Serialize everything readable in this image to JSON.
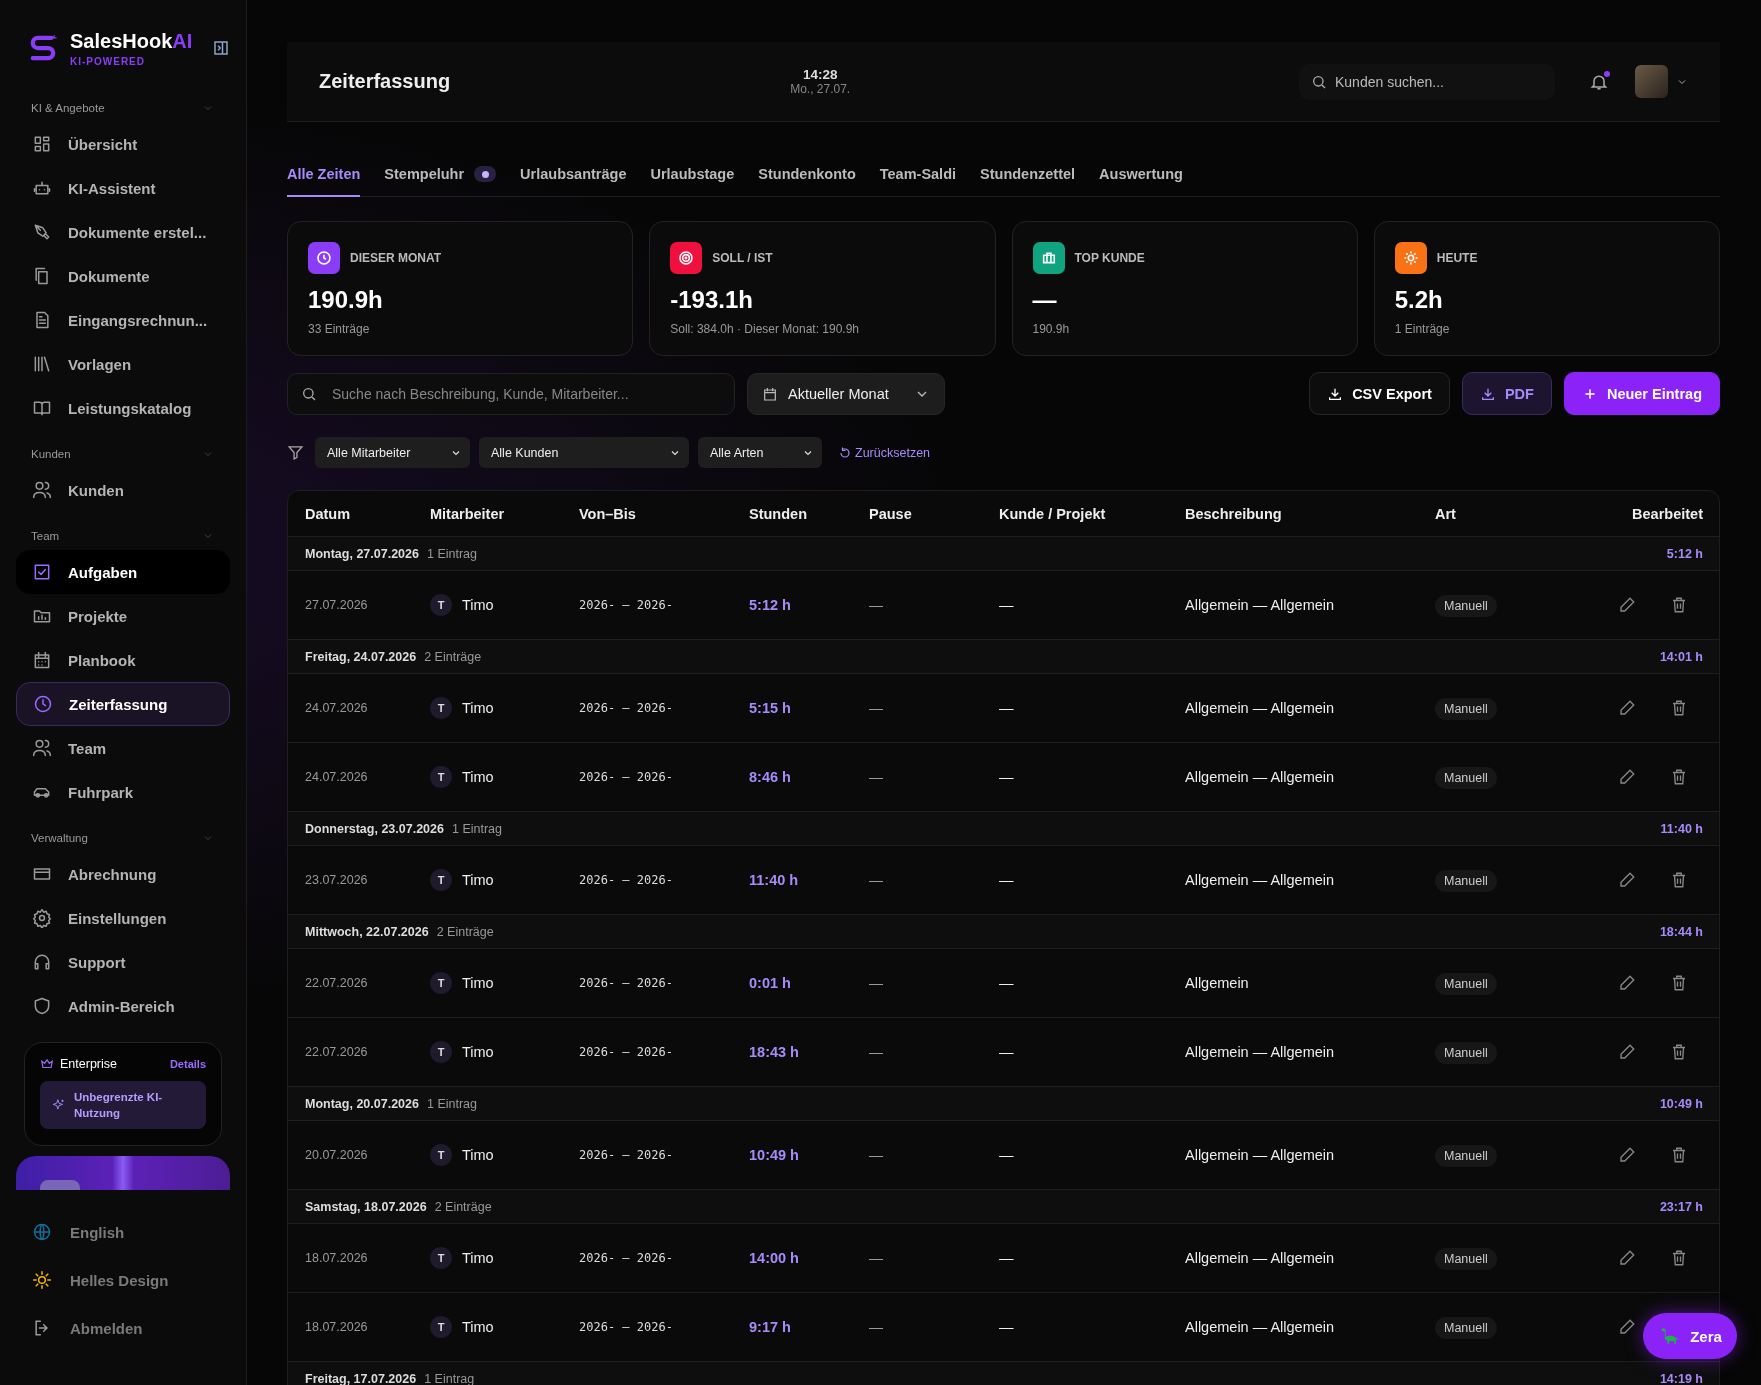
{
  "sidebar": {
    "brand": {
      "name": "SalesHook",
      "accent": "AI",
      "tagline": "KI-POWERED"
    },
    "sections": [
      {
        "title": "KI & Angebote",
        "expanded": true,
        "items": [
          {
            "label": "Übersicht",
            "selected": false,
            "hovered": false
          },
          {
            "label": "KI-Assistent",
            "selected": false,
            "hovered": false
          },
          {
            "label": "Dokumente erstel...",
            "selected": false,
            "hovered": false
          },
          {
            "label": "Dokumente",
            "selected": false,
            "hovered": false
          },
          {
            "label": "Eingangsrechnun...",
            "selected": false,
            "hovered": false
          },
          {
            "label": "Vorlagen",
            "selected": false,
            "hovered": false
          },
          {
            "label": "Leistungskatalog",
            "selected": false,
            "hovered": false
          }
        ]
      },
      {
        "title": "Kunden",
        "expanded": true,
        "items": [
          {
            "label": "Kunden",
            "selected": false,
            "hovered": false
          }
        ]
      },
      {
        "title": "Team",
        "expanded": true,
        "items": [
          {
            "label": "Aufgaben",
            "selected": false,
            "hovered": true
          },
          {
            "label": "Projekte",
            "selected": false,
            "hovered": false
          },
          {
            "label": "Planbook",
            "selected": false,
            "hovered": false
          },
          {
            "label": "Zeiterfassung",
            "selected": true,
            "hovered": false
          },
          {
            "label": "Team",
            "selected": false,
            "hovered": false
          },
          {
            "label": "Fuhrpark",
            "selected": false,
            "hovered": false
          }
        ]
      },
      {
        "title": "Verwaltung",
        "expanded": true,
        "items": [
          {
            "label": "Abrechnung",
            "selected": false,
            "hovered": false
          },
          {
            "label": "Einstellungen",
            "selected": false,
            "hovered": false
          },
          {
            "label": "Support",
            "selected": false,
            "hovered": false
          },
          {
            "label": "Admin-Bereich",
            "selected": false,
            "hovered": false
          }
        ]
      }
    ],
    "plan": {
      "name": "Enterprise",
      "link": "Details",
      "feature": "Unbegrenzte KI-Nutzung"
    },
    "footer": [
      {
        "label": "English"
      },
      {
        "label": "Helles Design"
      },
      {
        "label": "Abmelden"
      }
    ]
  },
  "header": {
    "title": "Zeiterfassung",
    "time": "14:28",
    "date": "Mo., 27.07.",
    "search": {
      "placeholder": "Kunden suchen..."
    },
    "unread": true
  },
  "tabs": [
    {
      "label": "Alle Zeiten",
      "selected": true,
      "live": false
    },
    {
      "label": "Stempeluhr",
      "selected": false,
      "live": true
    },
    {
      "label": "Urlaubsanträge",
      "selected": false,
      "live": false
    },
    {
      "label": "Urlaubstage",
      "selected": false,
      "live": false
    },
    {
      "label": "Stundenkonto",
      "selected": false,
      "live": false
    },
    {
      "label": "Team-Saldi",
      "selected": false,
      "live": false
    },
    {
      "label": "Stundenzettel",
      "selected": false,
      "live": false
    },
    {
      "label": "Auswertung",
      "selected": false,
      "live": false
    }
  ],
  "stats": [
    {
      "label": "DIESER MONAT",
      "value": "190.9h",
      "sub": "33 Einträge",
      "color": "#8b3cf7"
    },
    {
      "label": "SOLL / IST",
      "value": "-193.1h",
      "sub": "Soll: 384.0h · Dieser Monat: 190.9h",
      "color": "#f0103d"
    },
    {
      "label": "TOP KUNDE",
      "value": "—",
      "sub": "190.9h",
      "color": "#10a37f"
    },
    {
      "label": "HEUTE",
      "value": "5.2h",
      "sub": "1 Einträge",
      "color": "#f97316"
    }
  ],
  "toolbar": {
    "search": {
      "placeholder": "Suche nach Beschreibung, Kunde, Mitarbeiter..."
    },
    "period": "Aktueller Monat",
    "buttons": [
      {
        "label": "CSV Export",
        "kind": "plain"
      },
      {
        "label": "PDF",
        "kind": "outline"
      },
      {
        "label": "Neuer Eintrag",
        "kind": "primary"
      }
    ]
  },
  "filters": {
    "selects": [
      "Alle Mitarbeiter",
      "Alle Kunden",
      "Alle Arten"
    ],
    "reset": "Zurücksetzen"
  },
  "table": {
    "columns": [
      "Datum",
      "Mitarbeiter",
      "Von–Bis",
      "Stunden",
      "Pause",
      "Kunde / Projekt",
      "Beschreibung",
      "Art",
      "Bearbeitet"
    ],
    "groups": [
      {
        "day": "Montag, 27.07.2026",
        "count": "1 Eintrag",
        "total": "5:12 h",
        "rows": [
          {
            "date": "27.07.2026",
            "initial": "T",
            "employee": "Timo",
            "range": "2026- – 2026-",
            "hours": "5:12 h",
            "pause": "—",
            "client": "—",
            "description": "Allgemein — Allgemein",
            "type": "Manuell"
          }
        ]
      },
      {
        "day": "Freitag, 24.07.2026",
        "count": "2 Einträge",
        "total": "14:01 h",
        "rows": [
          {
            "date": "24.07.2026",
            "initial": "T",
            "employee": "Timo",
            "range": "2026- – 2026-",
            "hours": "5:15 h",
            "pause": "—",
            "client": "—",
            "description": "Allgemein — Allgemein",
            "type": "Manuell"
          },
          {
            "date": "24.07.2026",
            "initial": "T",
            "employee": "Timo",
            "range": "2026- – 2026-",
            "hours": "8:46 h",
            "pause": "—",
            "client": "—",
            "description": "Allgemein — Allgemein",
            "type": "Manuell"
          }
        ]
      },
      {
        "day": "Donnerstag, 23.07.2026",
        "count": "1 Eintrag",
        "total": "11:40 h",
        "rows": [
          {
            "date": "23.07.2026",
            "initial": "T",
            "employee": "Timo",
            "range": "2026- – 2026-",
            "hours": "11:40 h",
            "pause": "—",
            "client": "—",
            "description": "Allgemein — Allgemein",
            "type": "Manuell"
          }
        ]
      },
      {
        "day": "Mittwoch, 22.07.2026",
        "count": "2 Einträge",
        "total": "18:44 h",
        "rows": [
          {
            "date": "22.07.2026",
            "initial": "T",
            "employee": "Timo",
            "range": "2026- – 2026-",
            "hours": "0:01 h",
            "pause": "—",
            "client": "—",
            "description": "Allgemein",
            "type": "Manuell"
          },
          {
            "date": "22.07.2026",
            "initial": "T",
            "employee": "Timo",
            "range": "2026- – 2026-",
            "hours": "18:43 h",
            "pause": "—",
            "client": "—",
            "description": "Allgemein — Allgemein",
            "type": "Manuell"
          }
        ]
      },
      {
        "day": "Montag, 20.07.2026",
        "count": "1 Eintrag",
        "total": "10:49 h",
        "rows": [
          {
            "date": "20.07.2026",
            "initial": "T",
            "employee": "Timo",
            "range": "2026- – 2026-",
            "hours": "10:49 h",
            "pause": "—",
            "client": "—",
            "description": "Allgemein — Allgemein",
            "type": "Manuell"
          }
        ]
      },
      {
        "day": "Samstag, 18.07.2026",
        "count": "2 Einträge",
        "total": "23:17 h",
        "rows": [
          {
            "date": "18.07.2026",
            "initial": "T",
            "employee": "Timo",
            "range": "2026- – 2026-",
            "hours": "14:00 h",
            "pause": "—",
            "client": "—",
            "description": "Allgemein — Allgemein",
            "type": "Manuell"
          },
          {
            "date": "18.07.2026",
            "initial": "T",
            "employee": "Timo",
            "range": "2026- – 2026-",
            "hours": "9:17 h",
            "pause": "—",
            "client": "—",
            "description": "Allgemein — Allgemein",
            "type": "Manuell"
          }
        ]
      },
      {
        "day": "Freitag, 17.07.2026",
        "count": "1 Eintrag",
        "total": "14:19 h"
      }
    ]
  },
  "assistant": {
    "label": "Zera"
  }
}
